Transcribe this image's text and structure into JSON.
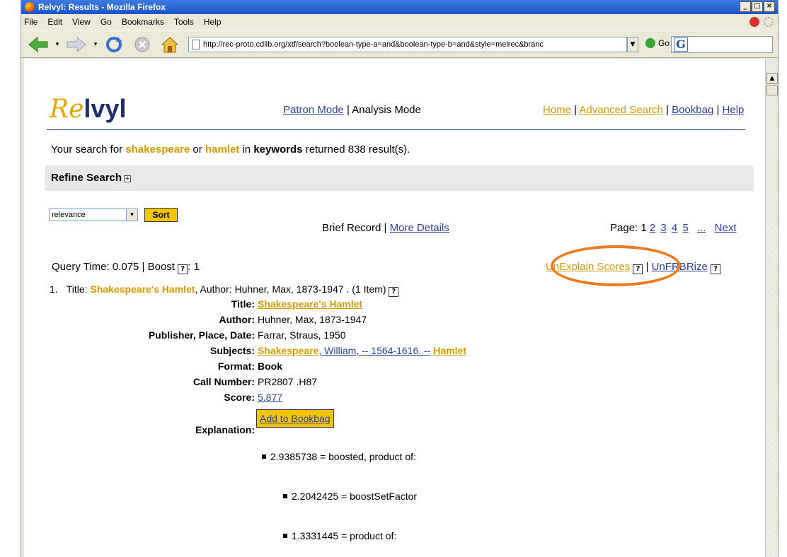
{
  "window": {
    "title": "Relvyl: Results - Mozilla Firefox"
  },
  "menu": [
    "File",
    "Edit",
    "View",
    "Go",
    "Bookmarks",
    "Tools",
    "Help"
  ],
  "nav": {
    "url": "http://rec-proto.cdlib.org/xtf/search?boolean-type-a=and&boolean-type-b=and&style=melrec&branc",
    "go_label": "Go"
  },
  "site": {
    "logo_prefix": "Re",
    "logo_suffix": "lvyl",
    "patron_mode": "Patron Mode",
    "analysis_mode": "Analysis Mode",
    "top_links": [
      "Home",
      "Advanced Search",
      "Bookbag",
      "Help"
    ]
  },
  "search": {
    "intro": "Your search for",
    "term1": "shakespeare",
    "or": "or",
    "term2": "hamlet",
    "in": "in",
    "field": "keywords",
    "returned": "returned 838 result(s)."
  },
  "refine": {
    "label": "Refine Search",
    "toggle": "+"
  },
  "sort": {
    "selected": "relevance",
    "button": "Sort"
  },
  "view": {
    "brief": "Brief Record",
    "more": "More Details"
  },
  "pager": {
    "label": "Page:",
    "current": "1",
    "pages": [
      "2",
      "3",
      "4",
      "5"
    ],
    "ellipsis": "...",
    "next": "Next"
  },
  "query": {
    "time": "Query Time: 0.075 | Boost",
    "boost_value": ": 1",
    "help": "?"
  },
  "explain": {
    "unexplain": "UnExplain Scores",
    "unfrbr": "UnFRBRize"
  },
  "record": {
    "num": "1.",
    "title_prefix": "Title:",
    "title": "Shakespeare's Hamlet",
    "author_segment": ", Author: Huhner, Max, 1873-1947 . (1 Item)",
    "fields": [
      {
        "label": "Title:",
        "value": "Shakespeare's Hamlet"
      },
      {
        "label": "Author:",
        "value": "Huhner, Max, 1873-1947"
      },
      {
        "label": "Publisher, Place, Date:",
        "value": "Farrar, Straus, 1950"
      },
      {
        "label": "Subjects:",
        "value_hl": "Shakespeare",
        "value_rest": ", William, -- 1564-1616. --",
        "value_hl2": "Hamlet"
      },
      {
        "label": "Format:",
        "value": "Book"
      },
      {
        "label": "Call Number:",
        "value": "PR2807 .H87"
      },
      {
        "label": "Score:",
        "value": "5.877"
      }
    ],
    "add_bookbag": "Add to Bookbag",
    "explanation_label": "Explanation:"
  },
  "explanation": [
    "2.9385738 = boosted, product of:",
    "2.2042425 = boostSetFactor",
    "1.3331445 = product of:"
  ],
  "colors": {
    "accent": "#d49b00",
    "link": "#2b3e9c",
    "button": "#f5c400",
    "annotation": "#f07a1e"
  }
}
